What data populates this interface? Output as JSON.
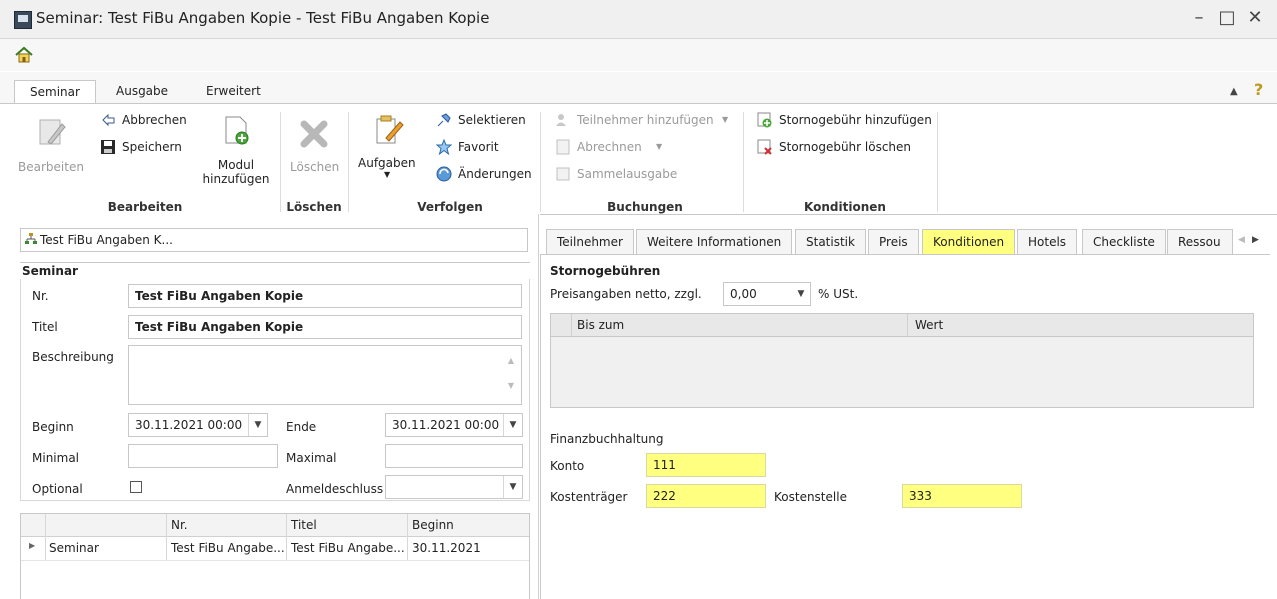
{
  "window": {
    "title": "Seminar: Test FiBu Angaben Kopie - Test FiBu Angaben Kopie",
    "minimize": "–",
    "maximize": "□",
    "close": "✕"
  },
  "ribbon": {
    "tabs": [
      "Seminar",
      "Ausgabe",
      "Erweitert"
    ],
    "help": "?",
    "collapse": "▲",
    "groups": {
      "bearbeiten": {
        "label": "Bearbeiten",
        "edit": "Bearbeiten",
        "cancel": "Abbrechen",
        "save": "Speichern",
        "add_module": "Modul\nhinzufügen"
      },
      "loeschen": {
        "label": "Löschen",
        "delete": "Löschen"
      },
      "verfolgen": {
        "label": "Verfolgen",
        "tasks": "Aufgaben",
        "select": "Selektieren",
        "favorite": "Favorit",
        "changes": "Änderungen"
      },
      "buchungen": {
        "label": "Buchungen",
        "add_participant": "Teilnehmer hinzufügen",
        "bill": "Abrechnen",
        "collective": "Sammelausgabe"
      },
      "konditionen": {
        "label": "Konditionen",
        "add_fee": "Stornogebühr hinzufügen",
        "delete_fee": "Stornogebühr löschen"
      }
    }
  },
  "left": {
    "nav_text": "Test FiBu Angaben K...",
    "section": "Seminar",
    "nr_label": "Nr.",
    "nr_value": "Test FiBu Angaben Kopie",
    "titel_label": "Titel",
    "titel_value": "Test FiBu Angaben Kopie",
    "desc_label": "Beschreibung",
    "beginn_label": "Beginn",
    "beginn_value": "30.11.2021 00:00",
    "ende_label": "Ende",
    "ende_value": "30.11.2021 00:00",
    "minimal_label": "Minimal",
    "maximal_label": "Maximal",
    "optional_label": "Optional",
    "anmeldeschluss_label": "Anmeldeschluss",
    "grid": {
      "columns": [
        "Nr.",
        "Titel",
        "Beginn"
      ],
      "rows": [
        {
          "type": "Seminar",
          "nr": "Test FiBu Angabe...",
          "titel": "Test FiBu Angabe...",
          "beginn": "30.11.2021"
        }
      ]
    }
  },
  "right": {
    "tabs": [
      "Teilnehmer",
      "Weitere Informationen",
      "Statistik",
      "Preis",
      "Konditionen",
      "Hotels",
      "Checkliste",
      "Ressou"
    ],
    "storno_title": "Stornogebühren",
    "preis_label": "Preisangaben netto, zzgl.",
    "ust_value": "0,00",
    "ust_label": "% USt.",
    "table_cols": [
      "Bis zum",
      "Wert"
    ],
    "fibu_title": "Finanzbuchhaltung",
    "konto_label": "Konto",
    "konto_value": "111",
    "kostentraeger_label": "Kostenträger",
    "kostentraeger_value": "222",
    "kostenstelle_label": "Kostenstelle",
    "kostenstelle_value": "333"
  }
}
